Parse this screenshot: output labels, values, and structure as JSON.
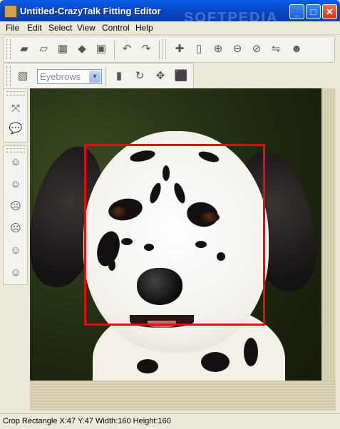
{
  "window": {
    "title": "Untitled-CrazyTalk Fitting Editor",
    "minimize_label": "_",
    "maximize_label": "□",
    "close_label": "✕"
  },
  "menu": [
    "File",
    "Edit",
    "Select",
    "View",
    "Control",
    "Help"
  ],
  "toolbar1": {
    "icons": [
      "new-icon",
      "open-icon",
      "save-icon",
      "export-icon",
      "exit-icon",
      "undo-icon",
      "redo-icon",
      "add-point-icon",
      "page-icon",
      "zoom-in-icon",
      "zoom-out-icon",
      "zoom-fit-icon",
      "mirror-icon",
      "face-icon"
    ]
  },
  "toolbar2": {
    "mode_select": "Eyebrows",
    "icons": [
      "mode-icon",
      "book-icon",
      "rotate-icon",
      "move-icon",
      "scale-icon"
    ]
  },
  "sidebar": {
    "tool_icons": [
      "arrange-icon",
      "speech-icon"
    ],
    "face_icons": [
      "face-neutral-icon",
      "face-happy-icon",
      "face-sad-icon",
      "face-angry-icon",
      "face-surprised-icon",
      "face-scared-icon"
    ]
  },
  "canvas": {
    "image_subject": "dalmatian dog",
    "crop_color": "#e01010"
  },
  "status": {
    "text": "Crop Rectangle X:47 Y:47 Width:160 Height:160"
  },
  "watermark": "SOFTPEDIA"
}
